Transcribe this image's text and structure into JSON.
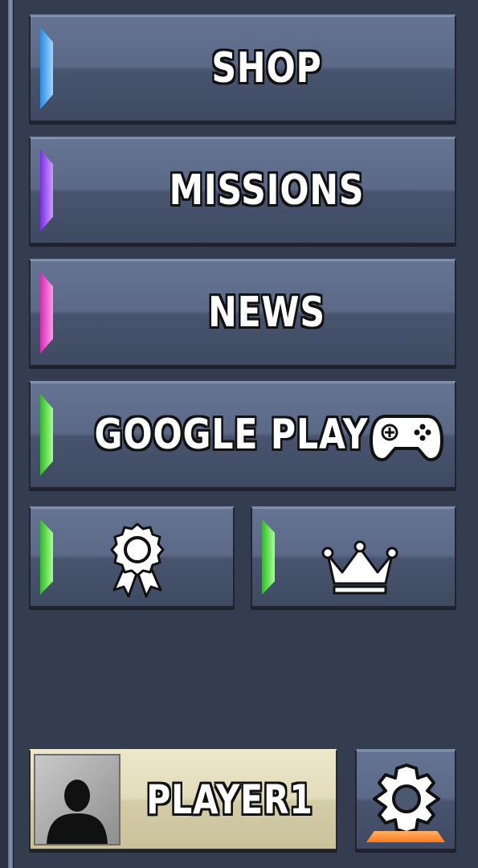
{
  "menu": {
    "shop_label": "SHOP",
    "missions_label": "MISSIONS",
    "news_label": "NEWS",
    "google_play_label": "GOOGLE PLAY"
  },
  "accent_colors": {
    "shop": "#4fb3ff",
    "missions": "#a35cff",
    "news": "#ff4fd2",
    "green": "#5be24a"
  },
  "icons": {
    "google_play": "gamepad-icon",
    "achievements": "award-ribbon-icon",
    "leaderboard": "crown-icon",
    "settings": "gear-icon",
    "avatar": "user-silhouette-icon"
  },
  "player": {
    "name": "PLAYER1"
  }
}
